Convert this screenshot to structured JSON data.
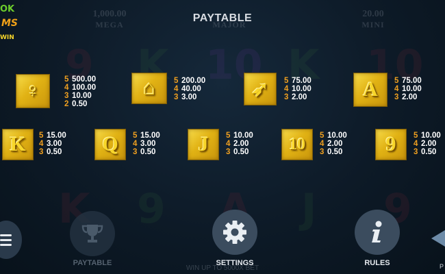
{
  "title": "PAYTABLE",
  "logo": {
    "line1": "OK",
    "line2": "MS",
    "line3": "WIN"
  },
  "jackpots": [
    {
      "amount": "1,000.00",
      "label": "MEGA"
    },
    {
      "amount": "",
      "label": "MAJOR"
    },
    {
      "amount": "20.00",
      "label": "MINI"
    }
  ],
  "symbols": [
    {
      "name": "goddess-archer",
      "glyph": "♀",
      "pays": [
        {
          "n": "5",
          "v": "500.00"
        },
        {
          "n": "4",
          "v": "100.00"
        },
        {
          "n": "3",
          "v": "10.00"
        },
        {
          "n": "2",
          "v": "0.50"
        }
      ]
    },
    {
      "name": "temple",
      "glyph": "⌂",
      "pays": [
        {
          "n": "5",
          "v": "200.00"
        },
        {
          "n": "4",
          "v": "40.00"
        },
        {
          "n": "3",
          "v": "3.00"
        }
      ]
    },
    {
      "name": "arrow",
      "glyph": "➶",
      "pays": [
        {
          "n": "5",
          "v": "75.00"
        },
        {
          "n": "4",
          "v": "10.00"
        },
        {
          "n": "3",
          "v": "2.00"
        }
      ]
    },
    {
      "name": "ace",
      "glyph": "A",
      "pays": [
        {
          "n": "5",
          "v": "75.00"
        },
        {
          "n": "4",
          "v": "10.00"
        },
        {
          "n": "3",
          "v": "2.00"
        }
      ]
    },
    {
      "name": "king",
      "glyph": "K",
      "pays": [
        {
          "n": "5",
          "v": "15.00"
        },
        {
          "n": "4",
          "v": "3.00"
        },
        {
          "n": "3",
          "v": "0.50"
        }
      ]
    },
    {
      "name": "queen",
      "glyph": "Q",
      "pays": [
        {
          "n": "5",
          "v": "15.00"
        },
        {
          "n": "4",
          "v": "3.00"
        },
        {
          "n": "3",
          "v": "0.50"
        }
      ]
    },
    {
      "name": "jack",
      "glyph": "J",
      "pays": [
        {
          "n": "5",
          "v": "10.00"
        },
        {
          "n": "4",
          "v": "2.00"
        },
        {
          "n": "3",
          "v": "0.50"
        }
      ]
    },
    {
      "name": "ten",
      "glyph": "10",
      "pays": [
        {
          "n": "5",
          "v": "10.00"
        },
        {
          "n": "4",
          "v": "2.00"
        },
        {
          "n": "3",
          "v": "0.50"
        }
      ]
    },
    {
      "name": "nine",
      "glyph": "9",
      "pays": [
        {
          "n": "5",
          "v": "10.00"
        },
        {
          "n": "4",
          "v": "2.00"
        },
        {
          "n": "3",
          "v": "0.50"
        }
      ]
    }
  ],
  "buttons": {
    "paytable": {
      "label": "PAYTABLE",
      "icon": "trophy-icon"
    },
    "settings": {
      "label": "SETTINGS",
      "icon": "gear-icon"
    },
    "rules": {
      "label": "RULES",
      "icon": "info-icon"
    }
  },
  "footer_note": "WIN UP TO 5000X BET",
  "nav_label": "P",
  "colors": {
    "gold": "#e1b214",
    "count": "#f0a020",
    "button": "#3b4c5e"
  }
}
